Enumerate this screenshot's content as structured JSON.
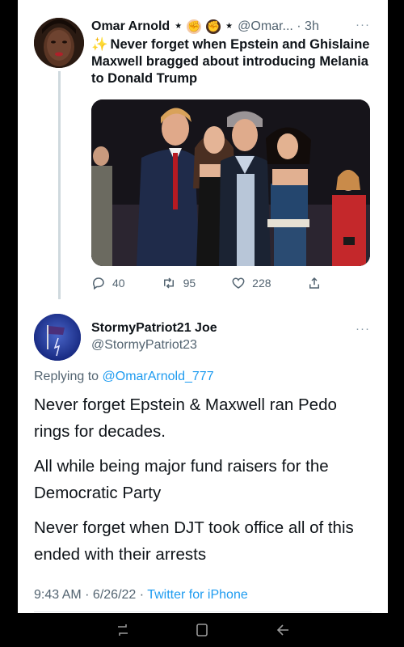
{
  "tweet1": {
    "author_name": "Omar Arnold",
    "handle": "@Omar... · 3h",
    "sparkle": "✨",
    "text": "Never forget when Epstein and Ghislaine Maxwell bragged about introducing Melania to Donald Trump",
    "more": "···",
    "actions": {
      "replies": "40",
      "retweets": "95",
      "likes": "228"
    }
  },
  "tweet2": {
    "author_name": "StormyPatriot21 Joe",
    "handle": "@StormyPatriot23",
    "more": "···",
    "replying_prefix": "Replying to ",
    "replying_to": "@OmarArnold_777",
    "paragraphs": [
      "Never forget Epstein & Maxwell ran Pedo rings for decades.",
      "All while being major fund raisers for the Democratic Party",
      "Never forget when DJT took office all of this ended with their arrests"
    ],
    "time_date": "9:43 AM · 6/26/22 · ",
    "source": "Twitter for iPhone"
  },
  "icons": {
    "reply": "reply-icon",
    "retweet": "retweet-icon",
    "like": "heart-icon",
    "share": "share-icon",
    "nav_recents": "recents-icon",
    "nav_home": "home-icon",
    "nav_back": "back-icon"
  },
  "colors": {
    "link": "#1d9bf0",
    "secondary_text": "#536471",
    "primary_text": "#0f1419",
    "background": "#ffffff"
  }
}
